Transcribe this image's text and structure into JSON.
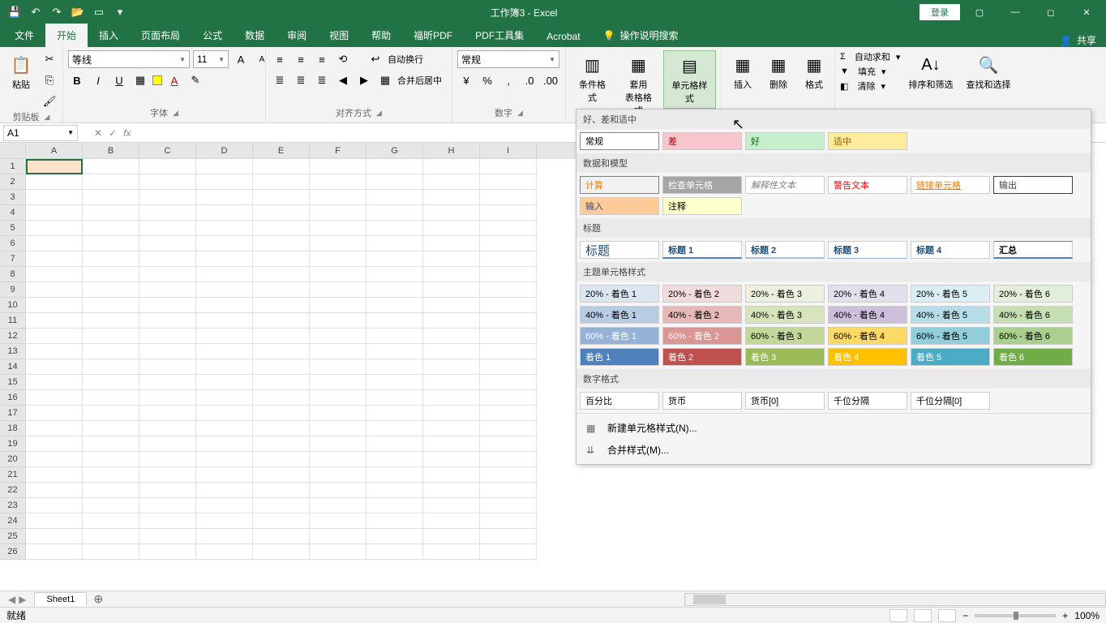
{
  "title": "工作簿3 - Excel",
  "qat": {
    "save": "💾",
    "undo": "↶",
    "redo": "↷",
    "open": "📂",
    "touch": "▭"
  },
  "login": "登录",
  "share_label": "共享",
  "tabs": [
    "文件",
    "开始",
    "插入",
    "页面布局",
    "公式",
    "数据",
    "审阅",
    "视图",
    "帮助",
    "福昕PDF",
    "PDF工具集",
    "Acrobat"
  ],
  "search_hint": "操作说明搜索",
  "ribbon": {
    "clipboard": {
      "paste": "粘贴",
      "label": "剪贴板"
    },
    "font": {
      "name": "等线",
      "size": "11",
      "label": "字体"
    },
    "align": {
      "wrap": "自动换行",
      "merge": "合并后居中",
      "label": "对齐方式"
    },
    "number": {
      "format": "常规",
      "label": "数字"
    },
    "styles": {
      "cond": "条件格式",
      "table": "套用\n表格格式",
      "cell": "单元格样式"
    },
    "cells": {
      "insert": "插入",
      "delete": "删除",
      "format": "格式"
    },
    "editing": {
      "sum": "自动求和",
      "fill": "填充",
      "clear": "清除",
      "sort": "排序和筛选",
      "find": "查找和选择"
    }
  },
  "name_box": "A1",
  "columns": [
    "A",
    "B",
    "C",
    "D",
    "E",
    "F",
    "G",
    "H",
    "I"
  ],
  "rows": [
    "1",
    "2",
    "3",
    "4",
    "5",
    "6",
    "7",
    "8",
    "9",
    "10",
    "11",
    "12",
    "13",
    "14",
    "15",
    "16",
    "17",
    "18",
    "19",
    "20",
    "21",
    "22",
    "23",
    "24",
    "25",
    "26"
  ],
  "styles_panel": {
    "s1_title": "好、差和适中",
    "s1": [
      {
        "t": "常规",
        "bg": "#fff",
        "c": "#000",
        "sel": true
      },
      {
        "t": "差",
        "bg": "#f8c7ce",
        "c": "#9c0006"
      },
      {
        "t": "好",
        "bg": "#c6efce",
        "c": "#006100"
      },
      {
        "t": "适中",
        "bg": "#ffeb9c",
        "c": "#9c5700"
      }
    ],
    "s2_title": "数据和模型",
    "s2": [
      {
        "t": "计算",
        "bg": "#f2f2f2",
        "c": "#fa7d00",
        "bd": "1px solid #7f7f7f"
      },
      {
        "t": "检查单元格",
        "bg": "#a5a5a5",
        "c": "#fff"
      },
      {
        "t": "解释性文本",
        "bg": "#fff",
        "c": "#7f7f7f",
        "fs": "italic"
      },
      {
        "t": "警告文本",
        "bg": "#fff",
        "c": "#ff0000"
      },
      {
        "t": "链接单元格",
        "bg": "#fff",
        "c": "#fa7d00",
        "td": "underline"
      },
      {
        "t": "输出",
        "bg": "#fff",
        "c": "#3f3f3f",
        "bd": "1px solid #3f3f3f"
      },
      {
        "t": "输入",
        "bg": "#ffcc99",
        "c": "#3f3f76"
      },
      {
        "t": "注释",
        "bg": "#ffffcc",
        "c": "#000"
      }
    ],
    "s3_title": "标题",
    "s3": [
      {
        "t": "标题",
        "bg": "#fff",
        "c": "#1f4e78",
        "fw": "400",
        "fz": "15px"
      },
      {
        "t": "标题 1",
        "bg": "#fff",
        "c": "#1f4e78",
        "fw": "bold",
        "bb": "2px solid #4f81bd"
      },
      {
        "t": "标题 2",
        "bg": "#fff",
        "c": "#1f4e78",
        "fw": "bold",
        "bb": "2px solid #a6bfde"
      },
      {
        "t": "标题 3",
        "bg": "#fff",
        "c": "#1f4e78",
        "fw": "bold",
        "bb": "1px solid #95b3d7"
      },
      {
        "t": "标题 4",
        "bg": "#fff",
        "c": "#1f4e78",
        "fw": "bold"
      },
      {
        "t": "汇总",
        "bg": "#fff",
        "c": "#000",
        "fw": "bold",
        "bb": "2px solid #4f81bd",
        "bt": "1px solid #4f81bd"
      }
    ],
    "s4_title": "主题单元格样式",
    "s4": [
      {
        "t": "20% - 着色 1",
        "bg": "#dce6f1"
      },
      {
        "t": "20% - 着色 2",
        "bg": "#f2dcdb"
      },
      {
        "t": "20% - 着色 3",
        "bg": "#ebf1de"
      },
      {
        "t": "20% - 着色 4",
        "bg": "#e4dfec"
      },
      {
        "t": "20% - 着色 5",
        "bg": "#daeef3"
      },
      {
        "t": "20% - 着色 6",
        "bg": "#e2efda"
      },
      {
        "t": "40% - 着色 1",
        "bg": "#b8cce4"
      },
      {
        "t": "40% - 着色 2",
        "bg": "#e6b8b7"
      },
      {
        "t": "40% - 着色 3",
        "bg": "#d8e4bc"
      },
      {
        "t": "40% - 着色 4",
        "bg": "#ccc0da"
      },
      {
        "t": "40% - 着色 5",
        "bg": "#b7dee8"
      },
      {
        "t": "40% - 着色 6",
        "bg": "#c6e0b4"
      },
      {
        "t": "60% - 着色 1",
        "bg": "#95b3d7",
        "c": "#fff"
      },
      {
        "t": "60% - 着色 2",
        "bg": "#da9694",
        "c": "#fff"
      },
      {
        "t": "60% - 着色 3",
        "bg": "#c4d79b"
      },
      {
        "t": "60% - 着色 4",
        "bg": "#ffd966"
      },
      {
        "t": "60% - 着色 5",
        "bg": "#92cddc"
      },
      {
        "t": "60% - 着色 6",
        "bg": "#a9d08e"
      },
      {
        "t": "着色 1",
        "bg": "#4f81bd",
        "c": "#fff"
      },
      {
        "t": "着色 2",
        "bg": "#c0504d",
        "c": "#fff"
      },
      {
        "t": "着色 3",
        "bg": "#9bbb59",
        "c": "#fff"
      },
      {
        "t": "着色 4",
        "bg": "#ffc000",
        "c": "#fff"
      },
      {
        "t": "着色 5",
        "bg": "#4bacc6",
        "c": "#fff"
      },
      {
        "t": "着色 6",
        "bg": "#70ad47",
        "c": "#fff"
      }
    ],
    "s5_title": "数字格式",
    "s5": [
      {
        "t": "百分比",
        "bg": "#fff"
      },
      {
        "t": "货币",
        "bg": "#fff"
      },
      {
        "t": "货币[0]",
        "bg": "#fff"
      },
      {
        "t": "千位分隔",
        "bg": "#fff"
      },
      {
        "t": "千位分隔[0]",
        "bg": "#fff"
      }
    ],
    "new_style": "新建单元格样式(N)...",
    "merge_style": "合并样式(M)..."
  },
  "sheet": "Sheet1",
  "status": "就绪",
  "zoom": "100%"
}
